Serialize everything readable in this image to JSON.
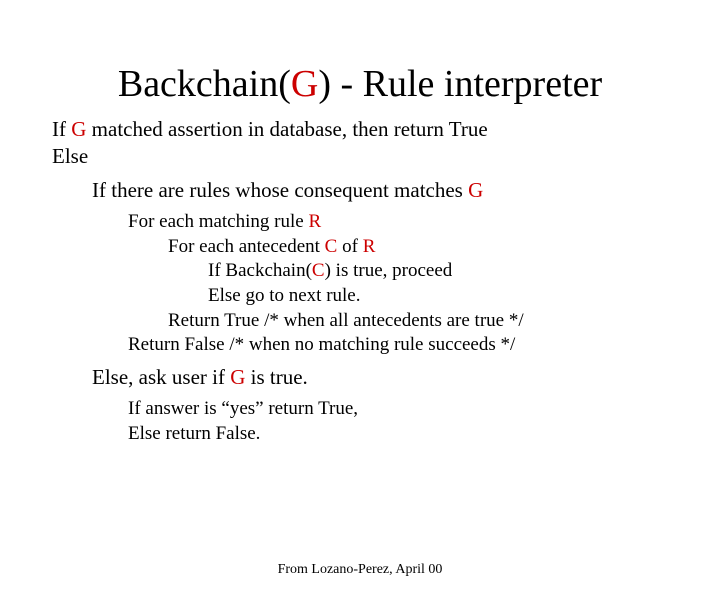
{
  "title": {
    "pre": "Backchain(",
    "accent": "G",
    "post": ") - Rule interpreter"
  },
  "lines": {
    "l1a": "If ",
    "l1g": "G",
    "l1b": " matched assertion in database, then return True",
    "l2": "Else",
    "l3a": "If there are rules whose consequent matches ",
    "l3g": "G",
    "l4a": "For each matching rule ",
    "l4r": "R",
    "l5a": "For each antecedent ",
    "l5c": "C",
    "l5b": " of ",
    "l5r": "R",
    "l6a": "If Backchain(",
    "l6c": "C",
    "l6b": ") is true, proceed",
    "l7": "Else go to next rule.",
    "l8": "Return True  /* when all antecedents are true */",
    "l9": "Return False /* when no matching rule succeeds */",
    "l10a": "Else, ask user if ",
    "l10g": "G",
    "l10b": " is true.",
    "l11": "If answer is “yes” return True,",
    "l12": "Else return False."
  },
  "attrib": "From Lozano-Perez, April 00"
}
